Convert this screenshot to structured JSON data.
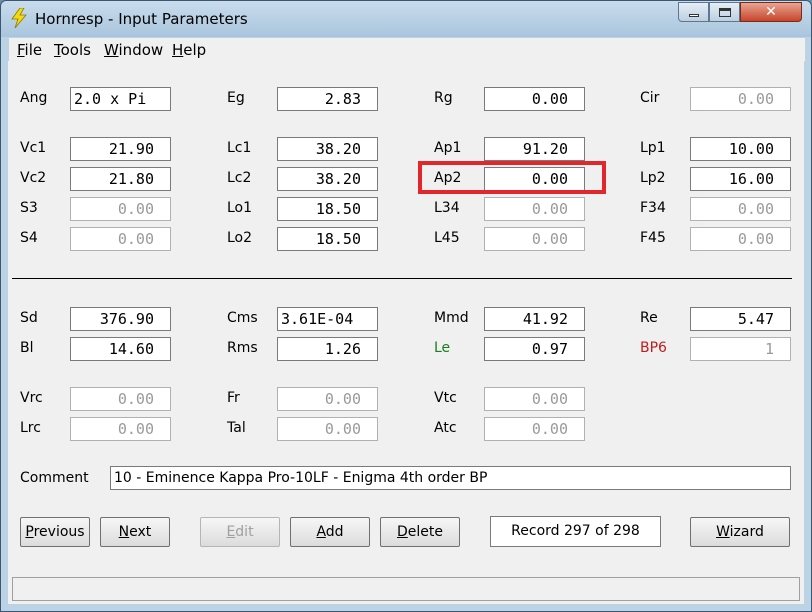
{
  "window": {
    "title": "Hornresp - Input Parameters"
  },
  "menu": [
    {
      "first": "F",
      "rest": "ile"
    },
    {
      "first": "T",
      "rest": "ools"
    },
    {
      "first": "W",
      "rest": "indow"
    },
    {
      "first": "H",
      "rest": "elp"
    }
  ],
  "params": {
    "ang": {
      "label": "Ang",
      "value": "2.0 x Pi"
    },
    "eg": {
      "label": "Eg",
      "value": "2.83"
    },
    "rg": {
      "label": "Rg",
      "value": "0.00"
    },
    "cir": {
      "label": "Cir",
      "value": "0.00"
    },
    "vc1": {
      "label": "Vc1",
      "value": "21.90"
    },
    "lc1": {
      "label": "Lc1",
      "value": "38.20"
    },
    "ap1": {
      "label": "Ap1",
      "value": "91.20"
    },
    "lp1": {
      "label": "Lp1",
      "value": "10.00"
    },
    "vc2": {
      "label": "Vc2",
      "value": "21.80"
    },
    "lc2": {
      "label": "Lc2",
      "value": "38.20"
    },
    "ap2": {
      "label": "Ap2",
      "value": "0.00"
    },
    "lp2": {
      "label": "Lp2",
      "value": "16.00"
    },
    "s3": {
      "label": "S3",
      "value": "0.00"
    },
    "lo1": {
      "label": "Lo1",
      "value": "18.50"
    },
    "l34": {
      "label": "L34",
      "value": "0.00"
    },
    "f34": {
      "label": "F34",
      "value": "0.00"
    },
    "s4": {
      "label": "S4",
      "value": "0.00"
    },
    "lo2": {
      "label": "Lo2",
      "value": "18.50"
    },
    "l45": {
      "label": "L45",
      "value": "0.00"
    },
    "f45": {
      "label": "F45",
      "value": "0.00"
    },
    "sd": {
      "label": "Sd",
      "value": "376.90"
    },
    "cms": {
      "label": "Cms",
      "value": "3.61E-04"
    },
    "mmd": {
      "label": "Mmd",
      "value": "41.92"
    },
    "re": {
      "label": "Re",
      "value": "5.47"
    },
    "bl": {
      "label": "Bl",
      "value": "14.60"
    },
    "rms": {
      "label": "Rms",
      "value": "1.26"
    },
    "le": {
      "label": "Le",
      "value": "0.97"
    },
    "bp6": {
      "label": "BP6",
      "value": "1"
    },
    "vrc": {
      "label": "Vrc",
      "value": "0.00"
    },
    "fr": {
      "label": "Fr",
      "value": "0.00"
    },
    "vtc": {
      "label": "Vtc",
      "value": "0.00"
    },
    "lrc": {
      "label": "Lrc",
      "value": "0.00"
    },
    "tal": {
      "label": "Tal",
      "value": "0.00"
    },
    "atc": {
      "label": "Atc",
      "value": "0.00"
    }
  },
  "comment": {
    "label": "Comment",
    "value": "10 - Eminence Kappa Pro-10LF - Enigma 4th order BP"
  },
  "buttons": {
    "previous": {
      "first": "P",
      "rest": "revious"
    },
    "next": {
      "first": "N",
      "rest": "ext"
    },
    "edit": {
      "first": "E",
      "rest": "dit"
    },
    "add": {
      "first": "A",
      "rest": "dd"
    },
    "delete": {
      "first": "D",
      "rest": "elete"
    },
    "wizard": {
      "first": "W",
      "rest": "izard"
    }
  },
  "record": "Record 297 of 298",
  "colors": {
    "highlight": "#e1262c",
    "le_label": "#1a7f1a",
    "bp6_label": "#c41a1a"
  }
}
